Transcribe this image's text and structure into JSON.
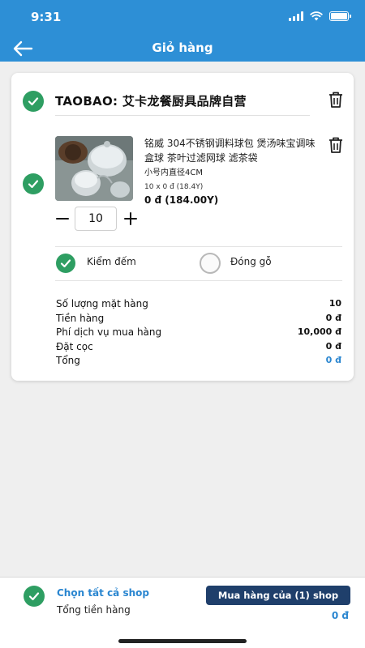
{
  "status_bar": {
    "time": "9:31"
  },
  "nav": {
    "title": "Giỏ hàng"
  },
  "shop": {
    "name": "TAOBAO: 艾卡龙餐厨具品牌自营"
  },
  "product": {
    "name": "铭威 304不锈钢调料球包 煲汤味宝调味盒球 茶叶过滤网球 滤茶袋",
    "variant": "小号内直径4CM",
    "calc": "10 x 0 đ (18.4Y)",
    "price": "0 đ (184.00Y)",
    "quantity": "10"
  },
  "options": {
    "count_label": "Kiểm đếm",
    "count_checked": true,
    "wood_label": "Đóng gỗ",
    "wood_checked": false
  },
  "summary": {
    "rows": [
      {
        "label": "Số lượng mặt hàng",
        "value": "10"
      },
      {
        "label": "Tiền hàng",
        "value": "0 đ"
      },
      {
        "label": "Phí dịch vụ mua hàng",
        "value": "10,000 đ"
      },
      {
        "label": "Đặt cọc",
        "value": "0 đ"
      },
      {
        "label": "Tổng",
        "value": "0 đ"
      }
    ]
  },
  "bottom": {
    "select_all": "Chọn tất cả shop",
    "total_label": "Tổng tiền hàng",
    "buy_button": "Mua hàng của (1) shop",
    "total_value": "0 đ"
  },
  "colors": {
    "primary": "#2d8fd6",
    "check": "#2e9e62",
    "button": "#1f3f6b",
    "accent_text": "#2a86d0"
  },
  "icons": [
    "back-arrow-icon",
    "wifi-icon",
    "signal-icon",
    "battery-icon",
    "check-icon",
    "trash-icon",
    "minus-icon",
    "plus-icon"
  ]
}
